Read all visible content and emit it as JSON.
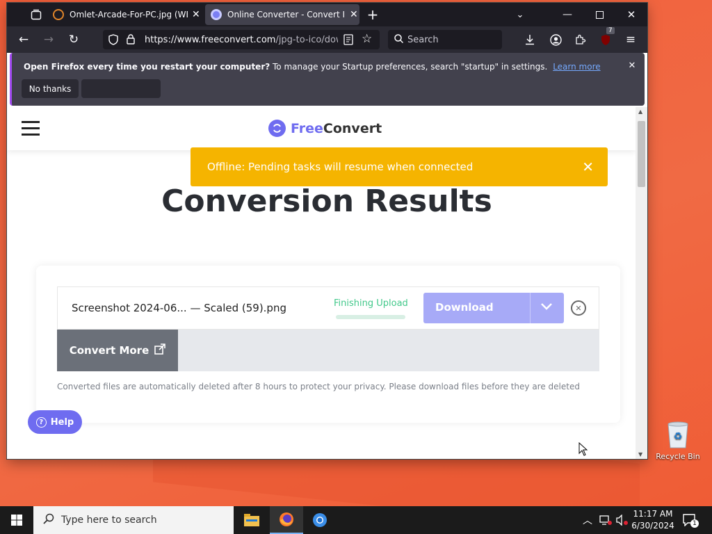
{
  "browser": {
    "tabs": [
      {
        "title": "Omlet-Arcade-For-PC.jpg (WEBP",
        "active": false
      },
      {
        "title": "Online Converter - Convert Imag",
        "active": true
      }
    ],
    "new_tab_label": "+",
    "url_host": "https://www.freeconvert.com",
    "url_path": "/jpg-to-ico/dow",
    "search_placeholder": "Search",
    "extension_badge": "7"
  },
  "notification": {
    "bold_text": "Open Firefox every time you restart your computer?",
    "text": " To manage your Startup preferences, search \"startup\" in settings.",
    "link": "Learn more",
    "no_thanks": "No thanks",
    "accent_color": "#a24cf0"
  },
  "site": {
    "logo_free": "Free",
    "logo_convert": "Convert",
    "page_title": "Conversion Results",
    "toast": "Offline: Pending tasks will resume when connected",
    "toast_color": "#f5b400",
    "file_name": "Screenshot 2024-06... — Scaled (59).png",
    "status": "Finishing Upload",
    "status_color": "#42c88a",
    "download_label": "Download",
    "download_color": "#a7aaf7",
    "convert_more": "Convert More",
    "privacy_note": "Converted files are automatically deleted after 8 hours to protect your privacy. Please download files before they are deleted",
    "help_label": "Help"
  },
  "desktop": {
    "recycle_bin": "Recycle Bin"
  },
  "taskbar": {
    "search_placeholder": "Type here to search",
    "time": "11:17 AM",
    "date": "6/30/2024",
    "notification_count": "1"
  }
}
